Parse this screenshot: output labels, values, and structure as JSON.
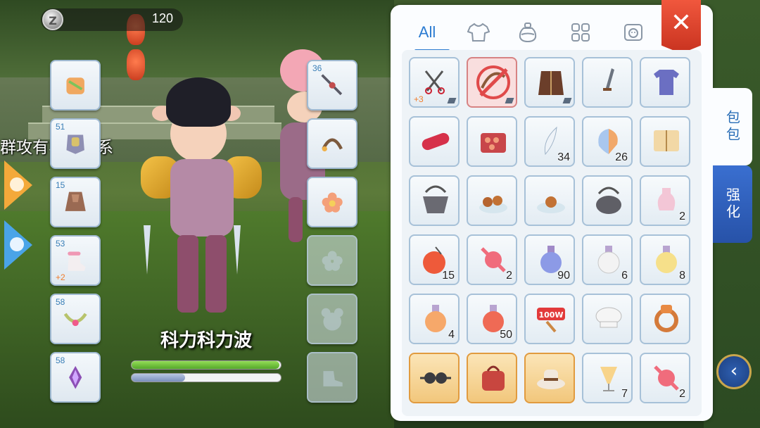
{
  "currency": {
    "icon": "zeny-coin-icon",
    "coin_letter": "Z",
    "amount": "120"
  },
  "marquee_text": "群攻有毛线关系",
  "character": {
    "name": "科力科力波",
    "hp_fill": 0.99,
    "sp_fill": 0.36
  },
  "equip_left": [
    {
      "name": "armor-icon",
      "level": "",
      "bonus": ""
    },
    {
      "name": "chest-armor-icon",
      "level": "51",
      "bonus": ""
    },
    {
      "name": "cloak-icon",
      "level": "15",
      "bonus": ""
    },
    {
      "name": "fur-boots-icon",
      "level": "53",
      "bonus": "+2"
    },
    {
      "name": "gem-necklace-icon",
      "level": "58",
      "bonus": ""
    },
    {
      "name": "purple-gem-icon",
      "level": "58",
      "bonus": ""
    }
  ],
  "equip_right": [
    {
      "name": "weapon-icon",
      "level": "36",
      "empty": false
    },
    {
      "name": "headband-icon",
      "level": "",
      "empty": false
    },
    {
      "name": "flower-icon",
      "level": "",
      "empty": false
    },
    {
      "name": "flower-slot-icon",
      "level": "",
      "empty": true
    },
    {
      "name": "bear-slot-icon",
      "level": "",
      "empty": true
    },
    {
      "name": "shoe-slot-icon",
      "level": "",
      "empty": true
    }
  ],
  "inventory": {
    "tabs": [
      {
        "label": "All",
        "icon": ""
      },
      {
        "label": "",
        "icon": "shirt-icon"
      },
      {
        "label": "",
        "icon": "potion-bag-icon"
      },
      {
        "label": "",
        "icon": "grid-icon"
      },
      {
        "label": "",
        "icon": "card-icon"
      }
    ],
    "close_label": "✕",
    "items": [
      {
        "name": "scissor-claw-icon",
        "count": "",
        "plus": "+3",
        "style": "normal",
        "corner": true
      },
      {
        "name": "bow-forbidden-icon",
        "count": "",
        "plus": "",
        "style": "sel",
        "corner": true
      },
      {
        "name": "leather-jacket-icon",
        "count": "",
        "plus": "",
        "style": "normal",
        "corner": true
      },
      {
        "name": "dagger-icon",
        "count": "",
        "plus": "",
        "style": "normal",
        "corner": false
      },
      {
        "name": "tshirt-icon",
        "count": "",
        "plus": "",
        "style": "normal",
        "corner": false
      },
      {
        "name": "red-candy-stick-icon",
        "count": "",
        "plus": "",
        "style": "normal",
        "corner": false
      },
      {
        "name": "lunch-box-icon",
        "count": "",
        "plus": "",
        "style": "normal",
        "corner": false
      },
      {
        "name": "feather-icon",
        "count": "34",
        "plus": "",
        "style": "normal",
        "corner": false
      },
      {
        "name": "butterfly-wing-icon",
        "count": "26",
        "plus": "",
        "style": "normal",
        "corner": false
      },
      {
        "name": "book-icon",
        "count": "",
        "plus": "",
        "style": "normal",
        "corner": false
      },
      {
        "name": "basket-pot-icon",
        "count": "",
        "plus": "",
        "style": "normal",
        "corner": false
      },
      {
        "name": "meat-dish-icon",
        "count": "",
        "plus": "",
        "style": "normal",
        "corner": false
      },
      {
        "name": "food-plate-icon",
        "count": "",
        "plus": "",
        "style": "normal",
        "corner": false
      },
      {
        "name": "cooking-pot-icon",
        "count": "",
        "plus": "",
        "style": "normal",
        "corner": false
      },
      {
        "name": "pink-vase-icon",
        "count": "2",
        "plus": "",
        "style": "normal",
        "corner": false
      },
      {
        "name": "apple-juice-icon",
        "count": "15",
        "plus": "",
        "style": "normal",
        "corner": false
      },
      {
        "name": "candy-icon",
        "count": "2",
        "plus": "",
        "style": "normal",
        "corner": false
      },
      {
        "name": "blue-potion-icon",
        "count": "90",
        "plus": "",
        "style": "normal",
        "corner": false
      },
      {
        "name": "white-potion-icon",
        "count": "6",
        "plus": "",
        "style": "normal",
        "corner": false
      },
      {
        "name": "yellow-potion-icon",
        "count": "8",
        "plus": "",
        "style": "normal",
        "corner": false
      },
      {
        "name": "orange-potion-icon",
        "count": "4",
        "plus": "",
        "style": "normal",
        "corner": false
      },
      {
        "name": "red-potion-icon",
        "count": "50",
        "plus": "",
        "style": "normal",
        "corner": false
      },
      {
        "name": "100w-sign-icon",
        "count": "",
        "plus": "",
        "style": "normal",
        "corner": false
      },
      {
        "name": "chef-hat-icon",
        "count": "",
        "plus": "",
        "style": "normal",
        "corner": false
      },
      {
        "name": "ring-icon",
        "count": "",
        "plus": "",
        "style": "normal",
        "corner": false
      },
      {
        "name": "goggles-icon",
        "count": "",
        "plus": "",
        "style": "gold",
        "corner": false
      },
      {
        "name": "red-bag-icon",
        "count": "",
        "plus": "",
        "style": "gold",
        "corner": false
      },
      {
        "name": "hat-icon",
        "count": "",
        "plus": "",
        "style": "gold",
        "corner": false
      },
      {
        "name": "cocktail-icon",
        "count": "7",
        "plus": "",
        "style": "normal",
        "corner": false
      },
      {
        "name": "candy-icon",
        "count": "2",
        "plus": "",
        "style": "normal",
        "corner": false
      }
    ]
  },
  "side_tabs": {
    "bag_label": "包包",
    "enhance_label": "强化"
  },
  "colors": {
    "accent": "#2b7bd1",
    "close": "#e0442c",
    "hp": "#6fc13a",
    "sp": "#8fa4c9",
    "gold_slot": "#f2c77c"
  }
}
